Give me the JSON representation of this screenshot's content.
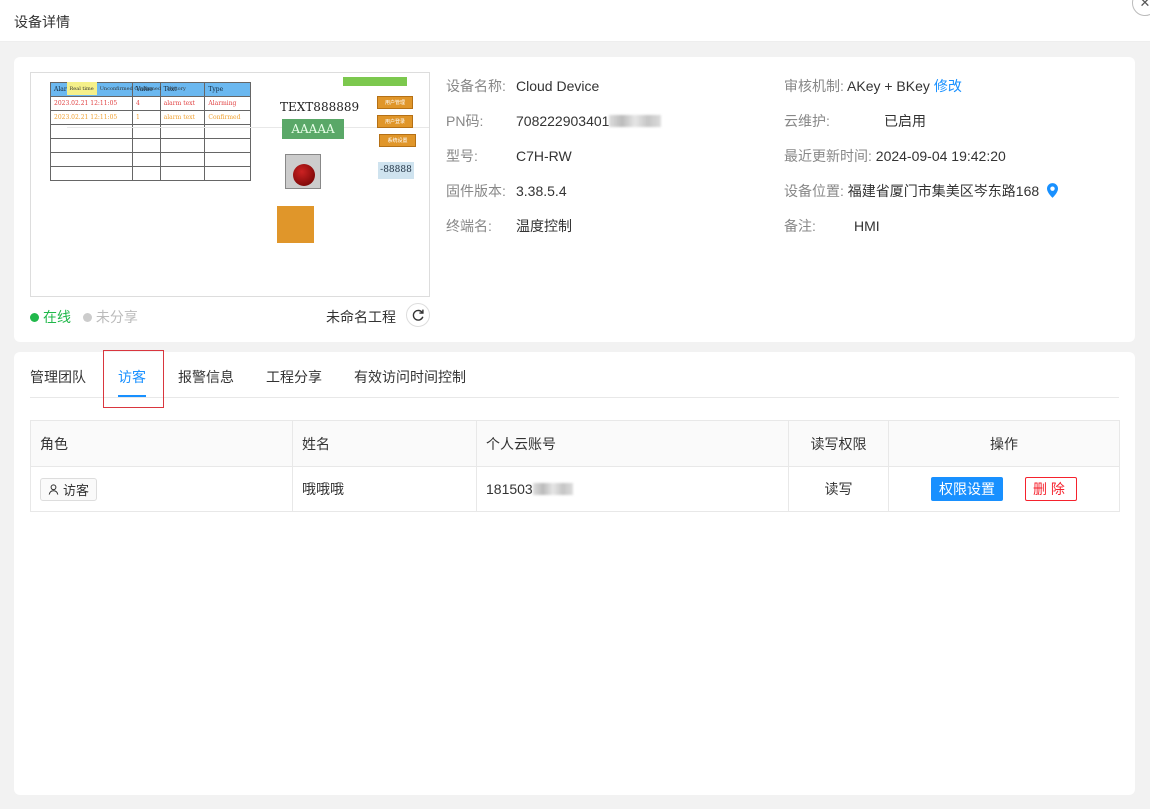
{
  "window": {
    "title": "设备详情"
  },
  "preview": {
    "table": {
      "tabs": [
        "Real time",
        "Unconfirmed",
        "Confirmed",
        "History"
      ],
      "headers": [
        "Alarm time",
        "Value",
        "Text",
        "Type"
      ],
      "rows": [
        [
          "2023.02.21 12:11:05",
          "4",
          "alarm text",
          "Alarming"
        ],
        [
          "2023.02.21 12:11:05",
          "1",
          "alarm text",
          "Confirmed"
        ]
      ]
    },
    "text_label": "TEXT888889",
    "green_label": "AAAAA",
    "buttons": [
      "用户管理",
      "用户登录",
      "系统设置"
    ],
    "number_display": "-88888"
  },
  "status": {
    "online": "在线",
    "unshared": "未分享"
  },
  "project_name": "未命名工程",
  "device_info": {
    "name": {
      "label": "设备名称:",
      "value": "Cloud Device"
    },
    "pn": {
      "label": "PN码:",
      "value": "708222903401"
    },
    "model": {
      "label": "型号:",
      "value": "C7H-RW"
    },
    "firmware": {
      "label": "固件版本:",
      "value": "3.38.5.4"
    },
    "terminal": {
      "label": "终端名:",
      "value": "温度控制"
    },
    "audit": {
      "label": "审核机制:",
      "value": "AKey + BKey",
      "link": "修改"
    },
    "cloud_maintain": {
      "label": "云维护:",
      "value": "已启用"
    },
    "updated": {
      "label": "最近更新时间:",
      "value": "2024-09-04 19:42:20"
    },
    "location": {
      "label": "设备位置:",
      "value": "福建省厦门市集美区岑东路168"
    },
    "remark": {
      "label": "备注:",
      "value": "HMI"
    }
  },
  "tabs": [
    "管理团队",
    "访客",
    "报警信息",
    "工程分享",
    "有效访问时间控制"
  ],
  "active_tab": "访客",
  "visitor_table": {
    "headers": {
      "role": "角色",
      "name": "姓名",
      "account": "个人云账号",
      "permission": "读写权限",
      "actions": "操作"
    },
    "rows": [
      {
        "role": "访客",
        "name": "哦哦哦",
        "account": "181503",
        "permission": "读写",
        "set_perm": "权限设置",
        "delete": "删除"
      }
    ]
  },
  "colors": {
    "accent": "#1890ff",
    "online": "#21b84b",
    "danger": "#f5222d"
  }
}
